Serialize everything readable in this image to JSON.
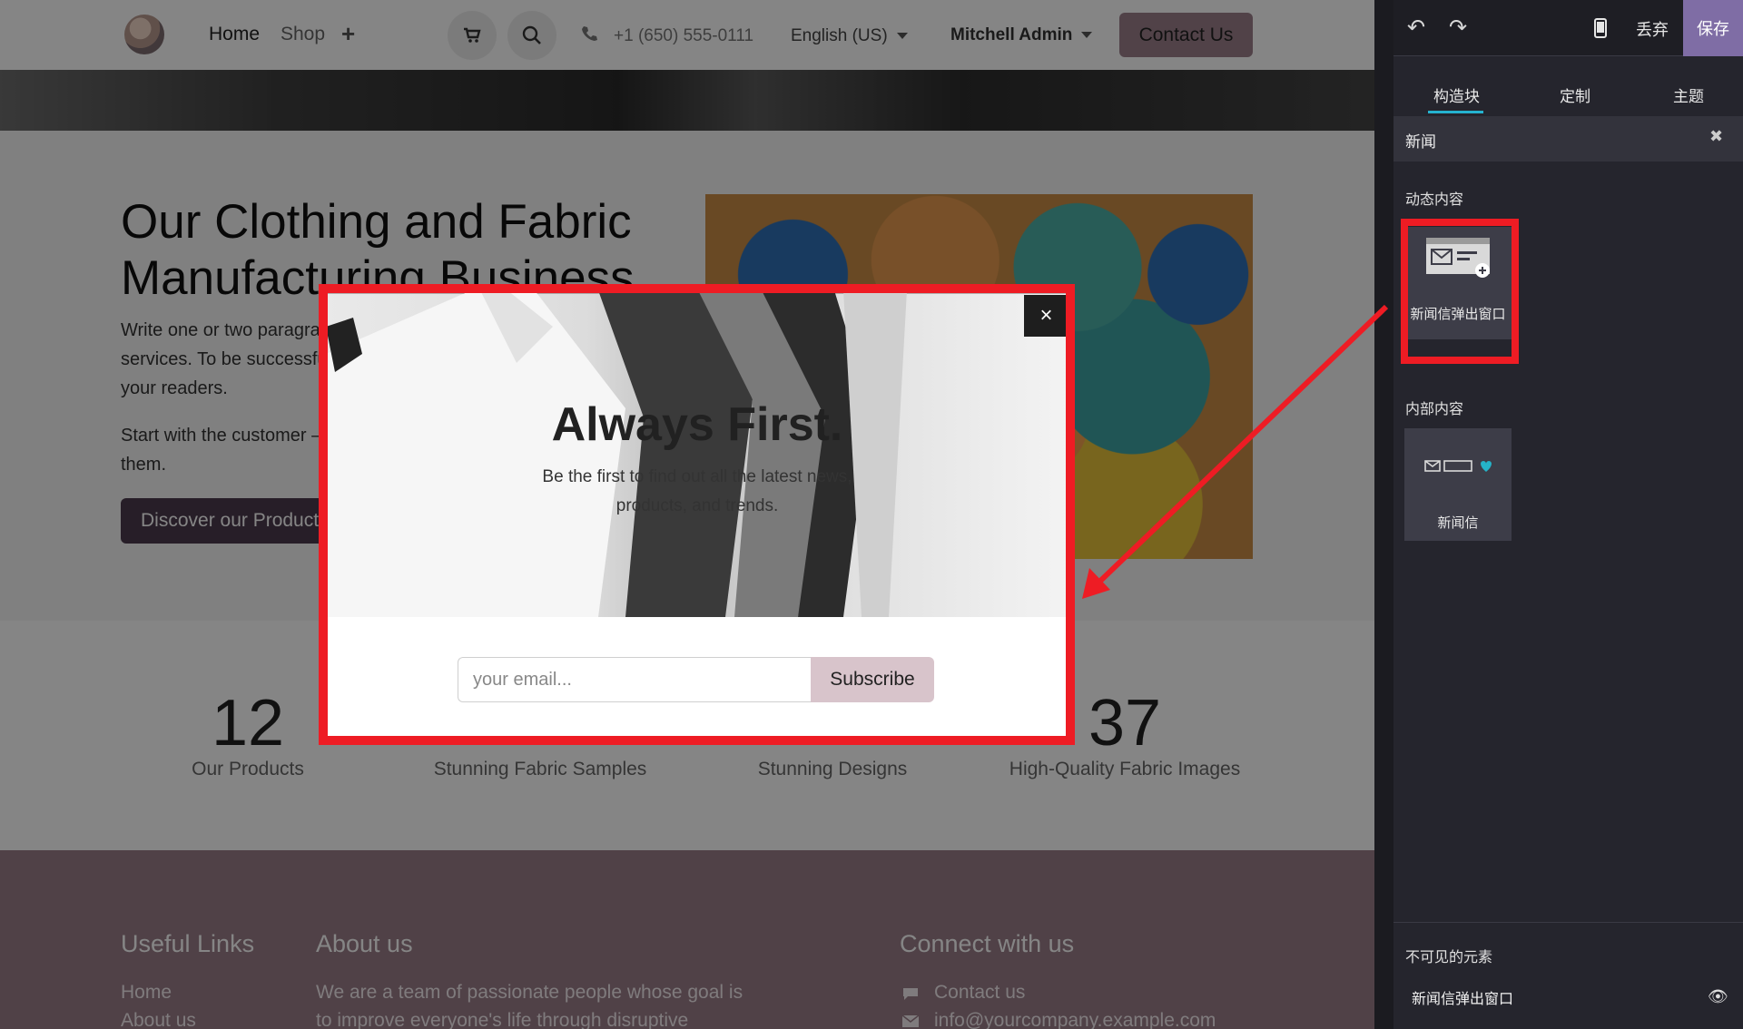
{
  "navbar": {
    "links": [
      "Home",
      "Shop"
    ],
    "phone": "+1 (650) 555-0111",
    "language": "English (US)",
    "user": "Mitchell Admin",
    "contact_label": "Contact Us"
  },
  "hero": {
    "title": "Our Clothing and Fabric Manufacturing Business",
    "p1": "Write one or two paragraphs describing your product or services. To be successful your content needs to be useful to your readers.",
    "p2": "Start with the customer – find out what they want and give it to them.",
    "cta": "Discover our Products"
  },
  "stats": [
    {
      "num": "12",
      "label": "Our Products"
    },
    {
      "num": "",
      "label": "Stunning Fabric Samples"
    },
    {
      "num": "",
      "label": "Stunning Designs"
    },
    {
      "num": "37",
      "label": "High-Quality Fabric Images"
    }
  ],
  "footer": {
    "col1_title": "Useful Links",
    "col1_links": [
      "Home",
      "About us"
    ],
    "col2_title": "About us",
    "col2_text_1": "We are a team of passionate people whose goal is",
    "col2_text_2": "to improve everyone's life through disruptive",
    "col3_title": "Connect with us",
    "col3_contact": "Contact us",
    "col3_email": "info@yourcompany.example.com"
  },
  "modal": {
    "title": "Always First.",
    "subtitle": "Be the first to find out all the latest news, products, and trends.",
    "email_placeholder": "your email...",
    "subscribe_label": "Subscribe",
    "close_label": "×"
  },
  "panel": {
    "discard_label": "丢弃",
    "save_label": "保存",
    "tabs": [
      "构造块",
      "定制",
      "主题"
    ],
    "search_value": "新闻",
    "dynamic_section": "动态内容",
    "dynamic_block_label": "新闻信弹出窗口",
    "inner_section": "内部内容",
    "inner_block_label": "新闻信",
    "invisible_title": "不可见的元素",
    "invisible_item": "新闻信弹出窗口"
  },
  "colors": {
    "accent_highlight": "#ee1c24",
    "save_bg": "#7f6da5",
    "tab_underline": "#25b3d0",
    "footer_bg": "#9a7d89"
  }
}
